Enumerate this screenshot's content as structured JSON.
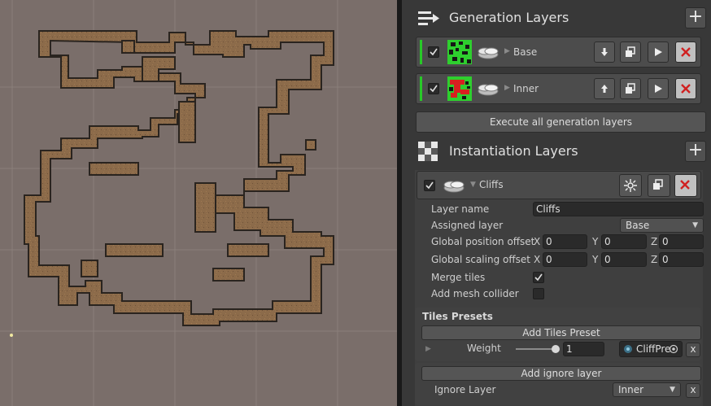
{
  "generation": {
    "title": "Generation Layers",
    "add_icon": "plus-icon",
    "layers": [
      {
        "name": "Base",
        "enabled": true
      },
      {
        "name": "Inner",
        "enabled": true
      }
    ],
    "execute_all_label": "Execute all generation layers"
  },
  "instantiation": {
    "title": "Instantiation Layers",
    "add_icon": "plus-icon",
    "layer": {
      "name": "Cliffs",
      "enabled": true,
      "props": {
        "layer_name_label": "Layer name",
        "layer_name_value": "Cliffs",
        "assigned_layer_label": "Assigned layer",
        "assigned_layer_value": "Base",
        "global_position_label": "Global position offset",
        "global_scaling_label": "Global scaling offset",
        "axis_x": "X",
        "axis_y": "Y",
        "axis_z": "Z",
        "position": {
          "x": "0",
          "y": "0",
          "z": "0"
        },
        "scaling": {
          "x": "0",
          "y": "0",
          "z": "0"
        },
        "merge_tiles_label": "Merge tiles",
        "merge_tiles": true,
        "mesh_collider_label": "Add mesh collider",
        "mesh_collider": false
      },
      "tiles_presets": {
        "title": "Tiles Presets",
        "add_label": "Add Tiles Preset",
        "weight_label": "Weight",
        "weight_value": "1",
        "weight_slider_fraction": 1.0,
        "preset_value": "CliffPre",
        "remove_label": "x"
      },
      "ignore": {
        "add_label": "Add ignore layer",
        "ignore_label": "Ignore Layer",
        "ignore_value": "Inner",
        "remove_label": "x"
      }
    }
  },
  "colors": {
    "scene_bg": "#7a6e6a",
    "terrain": "#8c6b4a",
    "active_green": "#28c928",
    "remove_red": "#d02020"
  }
}
